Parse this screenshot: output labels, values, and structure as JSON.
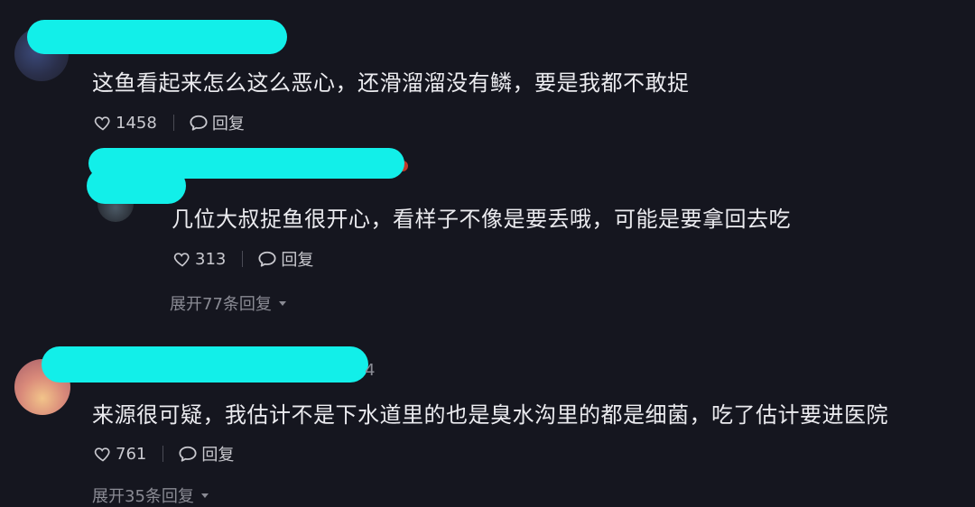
{
  "comments": [
    {
      "text": "这鱼看起来怎么这么恶心，还滑溜溜没有鳞，要是我都不敢捉",
      "likes": "1458",
      "reply_label": "回复"
    },
    {
      "text": "几位大叔捉鱼很开心，看样子不像是要丢哦，可能是要拿回去吃",
      "likes": "313",
      "reply_label": "回复",
      "expand_label": "展开77条回复"
    },
    {
      "text": "来源很可疑，我估计不是下水道里的也是臭水沟里的都是细菌，吃了估计要进医院",
      "likes": "761",
      "reply_label": "回复",
      "expand_label": "展开35条回复",
      "partial_meta": "4"
    }
  ],
  "colors": {
    "background": "#15161f",
    "redaction": "#12efe9",
    "text": "#ebebef",
    "muted": "#8a8b94"
  },
  "icons": [
    "heart-icon",
    "comment-bubble-icon",
    "caret-down-icon"
  ]
}
